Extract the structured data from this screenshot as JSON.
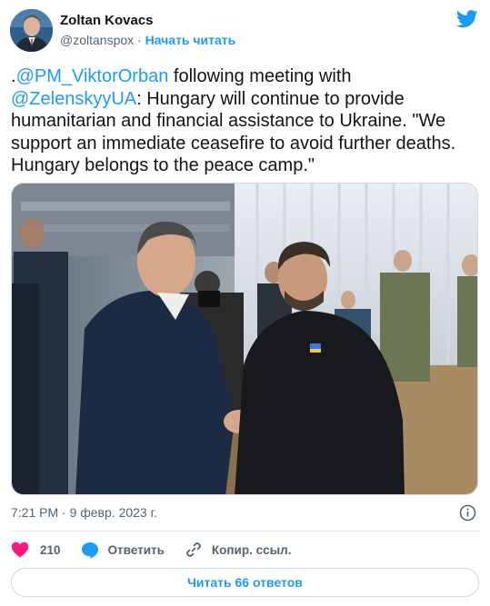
{
  "author": {
    "name": "Zoltan Kovacs",
    "handle": "@zoltanspox",
    "separator": "·",
    "follow_label": "Начать читать"
  },
  "tweet": {
    "segments": [
      {
        "text": ".",
        "type": "text"
      },
      {
        "text": "@PM_ViktorOrban",
        "type": "mention"
      },
      {
        "text": " following meeting with ",
        "type": "text"
      },
      {
        "text": "@ZelenskyyUA",
        "type": "mention"
      },
      {
        "text": ": Hungary will continue to provide humanitarian and financial assistance to Ukraine. \"We support an immediate ceasefire to avoid further deaths. Hungary belongs to the peace camp.\"",
        "type": "text"
      }
    ]
  },
  "timestamp": "7:21 PM · 9 февр. 2023 г.",
  "actions": {
    "likes_count": "210",
    "reply_label": "Ответить",
    "copy_link_label": "Копир. ссыл."
  },
  "read_replies_label": "Читать 66 ответов",
  "colors": {
    "accent": "#1d9bf0",
    "like": "#f91880",
    "text": "#0f1419",
    "secondary": "#536471"
  },
  "icons": [
    "twitter-logo-icon",
    "info-icon",
    "heart-icon",
    "reply-bubble-icon",
    "link-icon"
  ]
}
